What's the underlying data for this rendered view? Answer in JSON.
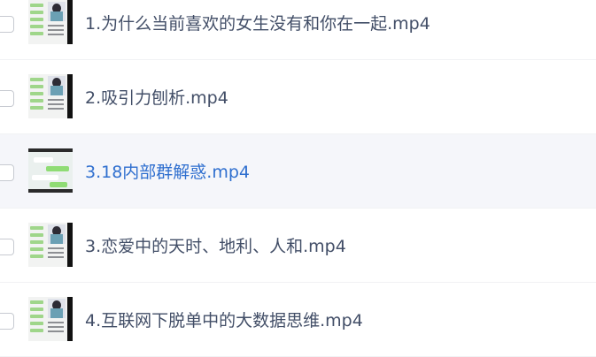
{
  "files": [
    {
      "name": "1.为什么当前喜欢的女生没有和你在一起.mp4",
      "thumbnail": "video-thumbnail",
      "highlighted": false
    },
    {
      "name": "2.吸引力刨析.mp4",
      "thumbnail": "video-thumbnail",
      "highlighted": false
    },
    {
      "name": "3.18内部群解惑.mp4",
      "thumbnail": "video-thumbnail-chat",
      "highlighted": true
    },
    {
      "name": "3.恋爱中的天时、地利、人和.mp4",
      "thumbnail": "video-thumbnail",
      "highlighted": false
    },
    {
      "name": "4.互联网下脱单中的大数据思维.mp4",
      "thumbnail": "video-thumbnail",
      "highlighted": false
    }
  ],
  "colors": {
    "text": "#424e67",
    "highlight_text": "#2f6fcf",
    "highlight_row": "#f5f6fa",
    "border": "#f1f2f4"
  }
}
